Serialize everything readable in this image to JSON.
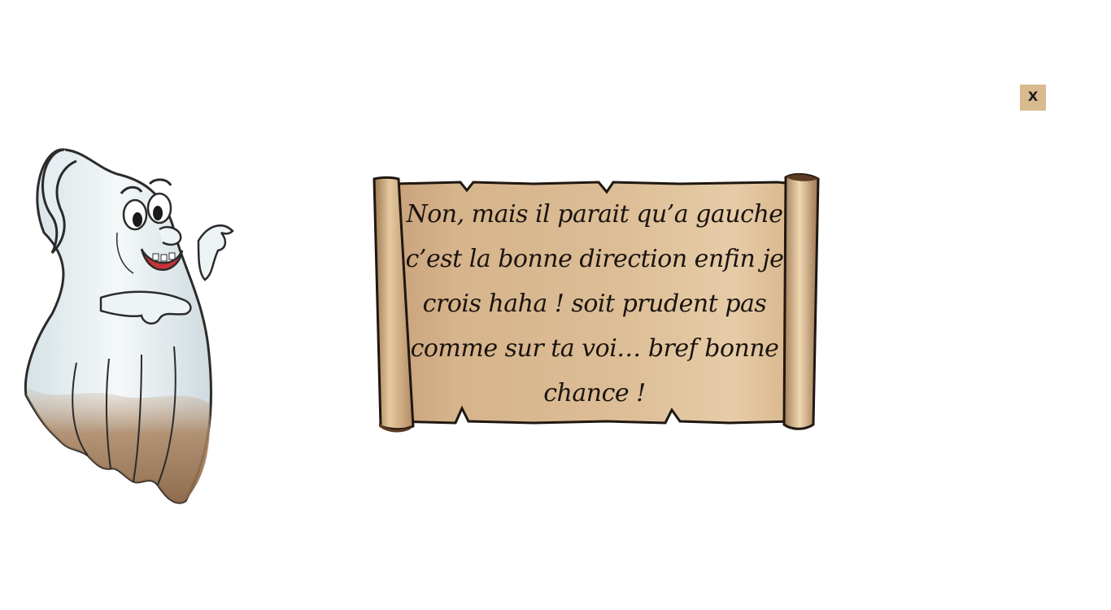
{
  "close_button": {
    "label": "X"
  },
  "dialog": {
    "text": "Non, mais il parait qu’a gauche c’est la bonne direction enfin je crois haha ! soit prudent pas comme sur ta voi… bref bonne chance !"
  },
  "character": {
    "icon": "ghost-character"
  },
  "colors": {
    "parchment_light": "#e8cfa5",
    "parchment_dark": "#b98e5e",
    "close_bg": "#d9b98e",
    "ghost_body": "#eef4f6",
    "ghost_outline": "#2b2b2b",
    "ghost_mud": "#b08a62"
  }
}
